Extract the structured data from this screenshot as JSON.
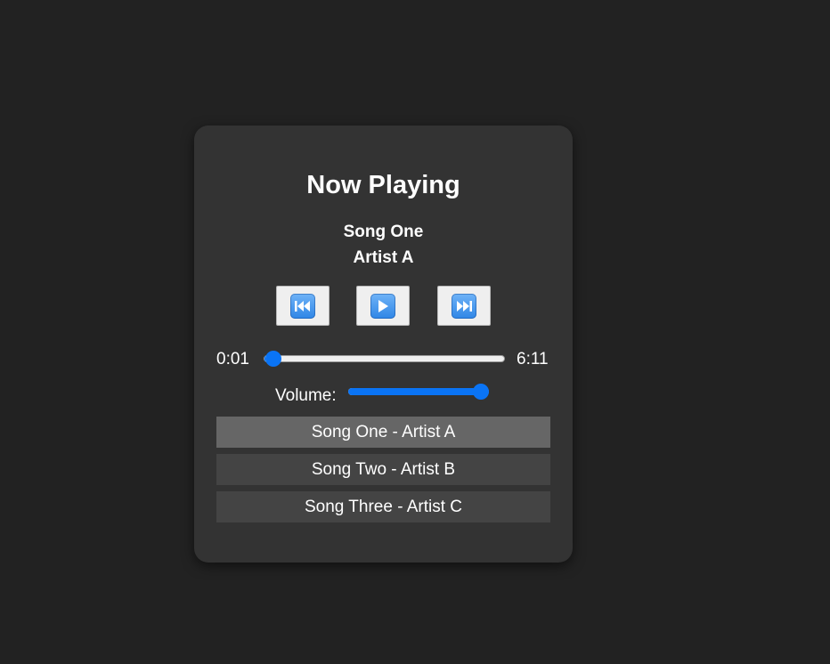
{
  "player": {
    "title": "Now Playing",
    "current_track": {
      "name": "Song One",
      "artist": "Artist A"
    },
    "controls": {
      "prev_icon": "previous-track-icon",
      "play_icon": "play-icon",
      "next_icon": "next-track-icon"
    },
    "progress": {
      "current_time": "0:01",
      "duration": "6:11",
      "fraction": 0.003
    },
    "volume": {
      "label": "Volume:",
      "level": 1.0
    },
    "playlist": [
      {
        "label": "Song One - Artist A",
        "active": true
      },
      {
        "label": "Song Two - Artist B",
        "active": false
      },
      {
        "label": "Song Three - Artist C",
        "active": false
      }
    ]
  },
  "colors": {
    "background": "#222222",
    "panel": "#333333",
    "accent": "#0a74f5",
    "playlist_item": "#444444",
    "playlist_active": "#666666"
  }
}
